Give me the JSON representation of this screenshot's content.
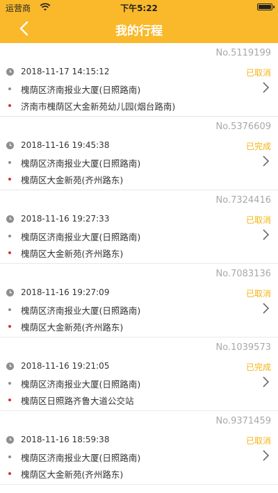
{
  "statusbar": {
    "carrier": "运营商",
    "time": "下午5:22"
  },
  "navbar": {
    "title": "我的行程",
    "back_icon": "chevron-left-icon"
  },
  "colors": {
    "header_bg": "#f9b92b",
    "status_text": "#f5b311",
    "from_dot": "#8e8e8e",
    "to_dot": "#d9322b"
  },
  "trips": [
    {
      "no": "No.5119199",
      "datetime": "2018-11-17 14:15:12",
      "status": "已取消",
      "from": "槐荫区济南报业大厦(日照路南)",
      "to": "济南市槐荫区大金新苑幼儿园(烟台路南)"
    },
    {
      "no": "No.5376609",
      "datetime": "2018-11-16 19:45:38",
      "status": "已完成",
      "from": "槐荫区济南报业大厦(日照路南)",
      "to": "槐荫区大金新苑(齐州路东)"
    },
    {
      "no": "No.7324416",
      "datetime": "2018-11-16 19:27:33",
      "status": "已取消",
      "from": "槐荫区济南报业大厦(日照路南)",
      "to": "槐荫区大金新苑(齐州路东)"
    },
    {
      "no": "No.7083136",
      "datetime": "2018-11-16 19:27:09",
      "status": "已取消",
      "from": "槐荫区济南报业大厦(日照路南)",
      "to": "槐荫区大金新苑(齐州路东)"
    },
    {
      "no": "No.1039573",
      "datetime": "2018-11-16 19:21:05",
      "status": "已完成",
      "from": "槐荫区济南报业大厦(日照路南)",
      "to": "槐荫区日照路齐鲁大道公交站"
    },
    {
      "no": "No.9371459",
      "datetime": "2018-11-16 18:59:38",
      "status": "已取消",
      "from": "槐荫区济南报业大厦(日照路南)",
      "to": "槐荫区大金新苑(齐州路东)"
    }
  ]
}
